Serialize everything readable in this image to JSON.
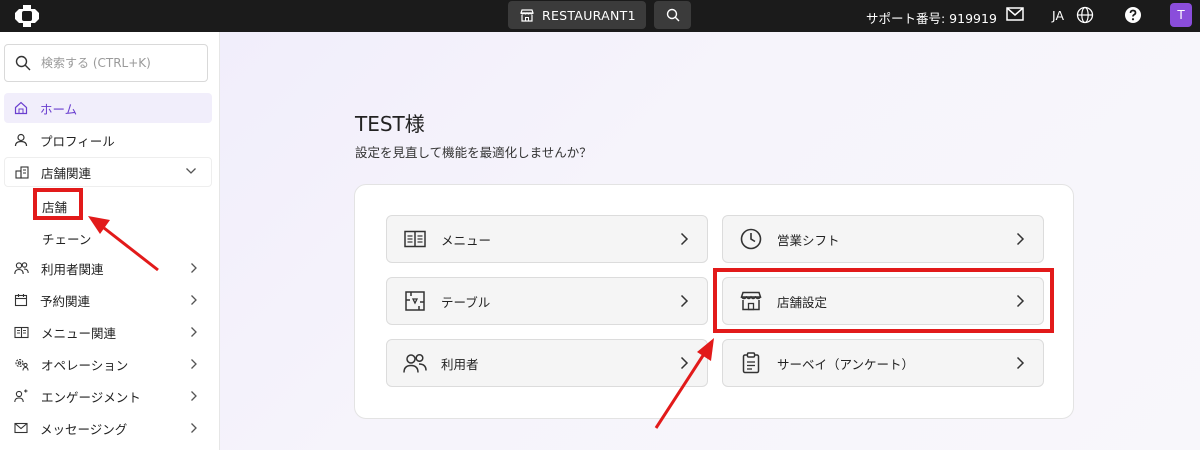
{
  "topbar": {
    "store_name": "RESTAURANT1",
    "support_label": "サポート番号: 919919",
    "language": "JA",
    "avatar_initial": "T",
    "avatar_color": "#8a4ddb"
  },
  "sidebar": {
    "search_placeholder": "検索する (CTRL+K)",
    "items": [
      {
        "label": "ホーム",
        "icon": "home-icon"
      },
      {
        "label": "プロフィール",
        "icon": "person-icon"
      },
      {
        "label": "店舗関連",
        "icon": "store-building-icon"
      },
      {
        "label": "利用者関連",
        "icon": "users-icon"
      },
      {
        "label": "予約関連",
        "icon": "calendar-icon"
      },
      {
        "label": "メニュー関連",
        "icon": "menu-book-icon"
      },
      {
        "label": "オペレーション",
        "icon": "gear-people-icon"
      },
      {
        "label": "エンゲージメント",
        "icon": "engagement-icon"
      },
      {
        "label": "メッセージング",
        "icon": "mail-icon"
      }
    ],
    "sub_items": [
      {
        "label": "店舗"
      },
      {
        "label": "チェーン"
      }
    ]
  },
  "main": {
    "greeting": "TEST様",
    "subtitle": "設定を見直して機能を最適化しませんか？",
    "cards": [
      {
        "label": "メニュー",
        "icon": "menu-book-icon"
      },
      {
        "label": "営業シフト",
        "icon": "clock-icon"
      },
      {
        "label": "テーブル",
        "icon": "table-layout-icon"
      },
      {
        "label": "店舗設定",
        "icon": "storefront-icon"
      },
      {
        "label": "利用者",
        "icon": "users-icon"
      },
      {
        "label": "サーベイ（アンケート）",
        "icon": "clipboard-icon"
      }
    ]
  },
  "colors": {
    "accent": "#6a3fcf",
    "annotation_red": "#e21a1a"
  }
}
